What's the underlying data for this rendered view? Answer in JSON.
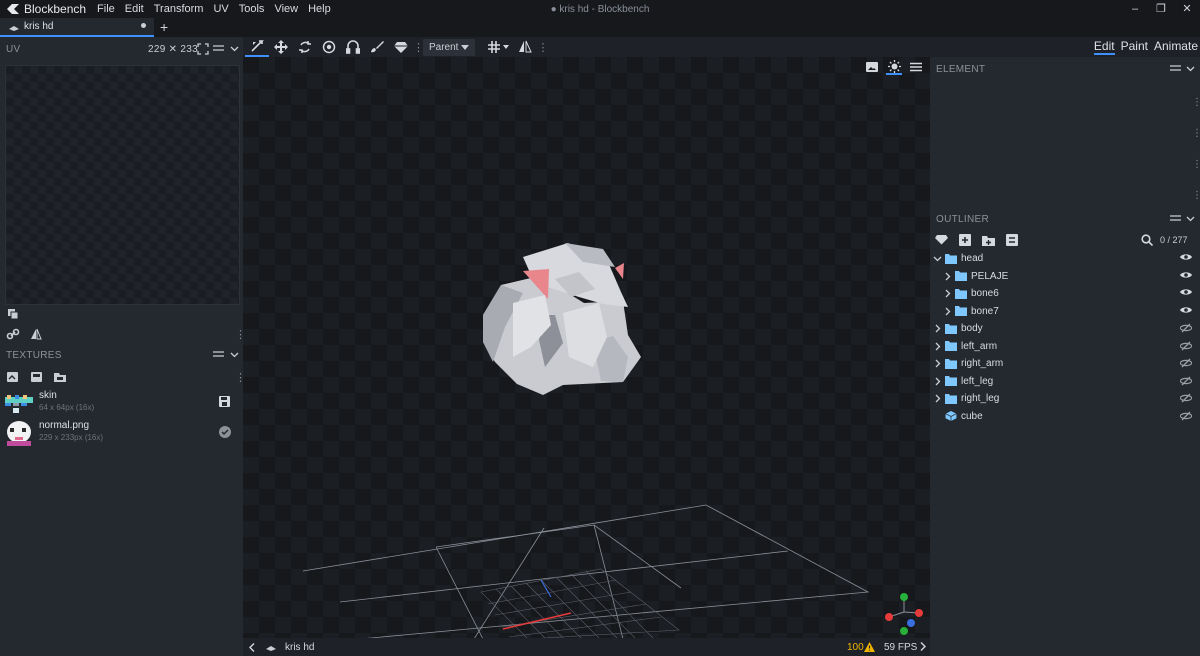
{
  "app": {
    "name": "Blockbench",
    "window_title": "● kris hd - Blockbench",
    "menu": [
      "File",
      "Edit",
      "Transform",
      "UV",
      "Tools",
      "View",
      "Help"
    ],
    "window_controls": [
      "–",
      "❐",
      "✕"
    ]
  },
  "tabs": {
    "file_tab": "kris hd",
    "add": "+"
  },
  "uv_panel": {
    "title": "UV",
    "size": "229 ✕ 233"
  },
  "textures_panel": {
    "title": "TEXTURES",
    "items": [
      {
        "name": "skin",
        "meta": "64 x 64px (16x)"
      },
      {
        "name": "normal.png",
        "meta": "229 x 233px (16x)"
      }
    ]
  },
  "toolbar": {
    "pivot_mode": "Parent"
  },
  "modes": [
    "Edit",
    "Paint",
    "Animate"
  ],
  "element_panel": {
    "title": "ELEMENT"
  },
  "outliner": {
    "title": "OUTLINER",
    "count": "0 / 277",
    "items": [
      {
        "label": "head",
        "depth": 0,
        "expanded": true,
        "type": "group",
        "visible": true
      },
      {
        "label": "PELAJE",
        "depth": 1,
        "expanded": false,
        "type": "group",
        "visible": true
      },
      {
        "label": "bone6",
        "depth": 1,
        "expanded": false,
        "type": "group",
        "visible": true
      },
      {
        "label": "bone7",
        "depth": 1,
        "expanded": false,
        "type": "group",
        "visible": true
      },
      {
        "label": "body",
        "depth": 0,
        "expanded": false,
        "type": "group",
        "visible": false
      },
      {
        "label": "left_arm",
        "depth": 0,
        "expanded": false,
        "type": "group",
        "visible": false
      },
      {
        "label": "right_arm",
        "depth": 0,
        "expanded": false,
        "type": "group",
        "visible": false
      },
      {
        "label": "left_leg",
        "depth": 0,
        "expanded": false,
        "type": "group",
        "visible": false
      },
      {
        "label": "right_leg",
        "depth": 0,
        "expanded": false,
        "type": "group",
        "visible": false
      },
      {
        "label": "cube",
        "depth": 0,
        "expanded": false,
        "type": "cube",
        "visible": false
      }
    ]
  },
  "status": {
    "project": "kris hd",
    "warnings": "100",
    "fps": "59 FPS"
  },
  "colors": {
    "accent": "#3e90ff",
    "folder": "#7ec8ff",
    "warning": "#f0b400"
  }
}
